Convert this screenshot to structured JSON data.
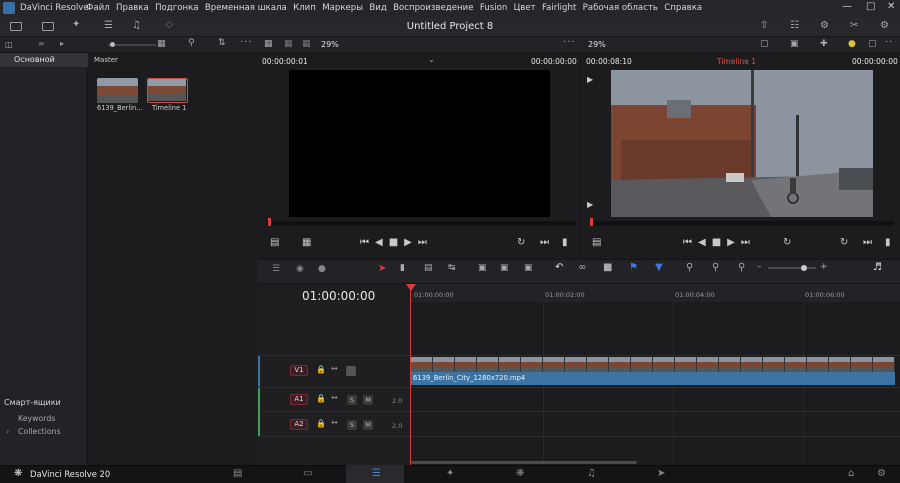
{
  "app": {
    "name": "DaVinci Resolve",
    "brand": "DaVinci Resolve 20"
  },
  "menu": [
    "Файл",
    "Правка",
    "Подгонка",
    "Временная шкала",
    "Клип",
    "Маркеры",
    "Вид",
    "Воспроизведение",
    "Fusion",
    "Цвет",
    "Fairlight",
    "Рабочая область",
    "Справка"
  ],
  "project_title": "Untitled Project 8",
  "viewer_zoom_left": "29%",
  "viewer_zoom_right": "29%",
  "left_panel": {
    "bin": "Основной",
    "smart_bins_title": "Смарт-ящики",
    "smart_bins": [
      "Keywords",
      "Collections"
    ]
  },
  "media_pool": {
    "folder": "Master",
    "clips": [
      {
        "name": "6139_Berlin..."
      },
      {
        "name": "Timeline 1"
      }
    ]
  },
  "source_viewer": {
    "timecode_left": "00:00:00:01",
    "timecode_right": "00:00:00:00"
  },
  "timeline_viewer": {
    "timecode_left": "00:00:08:10",
    "timeline_name": "Timeline 1",
    "timecode_right": "00:00:00:00"
  },
  "timeline": {
    "current_timecode": "01:00:00:00",
    "ruler_ticks": [
      "01:00:00:00",
      "01:00:02:00",
      "01:00:04:00",
      "01:00:06:00"
    ],
    "tracks": [
      {
        "id": "V1",
        "solo": "",
        "mute": ""
      },
      {
        "id": "A1",
        "solo": "S",
        "mute": "M",
        "volume": "2.0"
      },
      {
        "id": "A2",
        "solo": "S",
        "mute": "M",
        "volume": "2.0"
      }
    ],
    "clip_name": "6139_Berlin_City_1280x720.mp4"
  },
  "colors": {
    "accent_red": "#e03a3a",
    "clip_blue": "#3b74a3",
    "timeline_name": "#e0504a"
  }
}
